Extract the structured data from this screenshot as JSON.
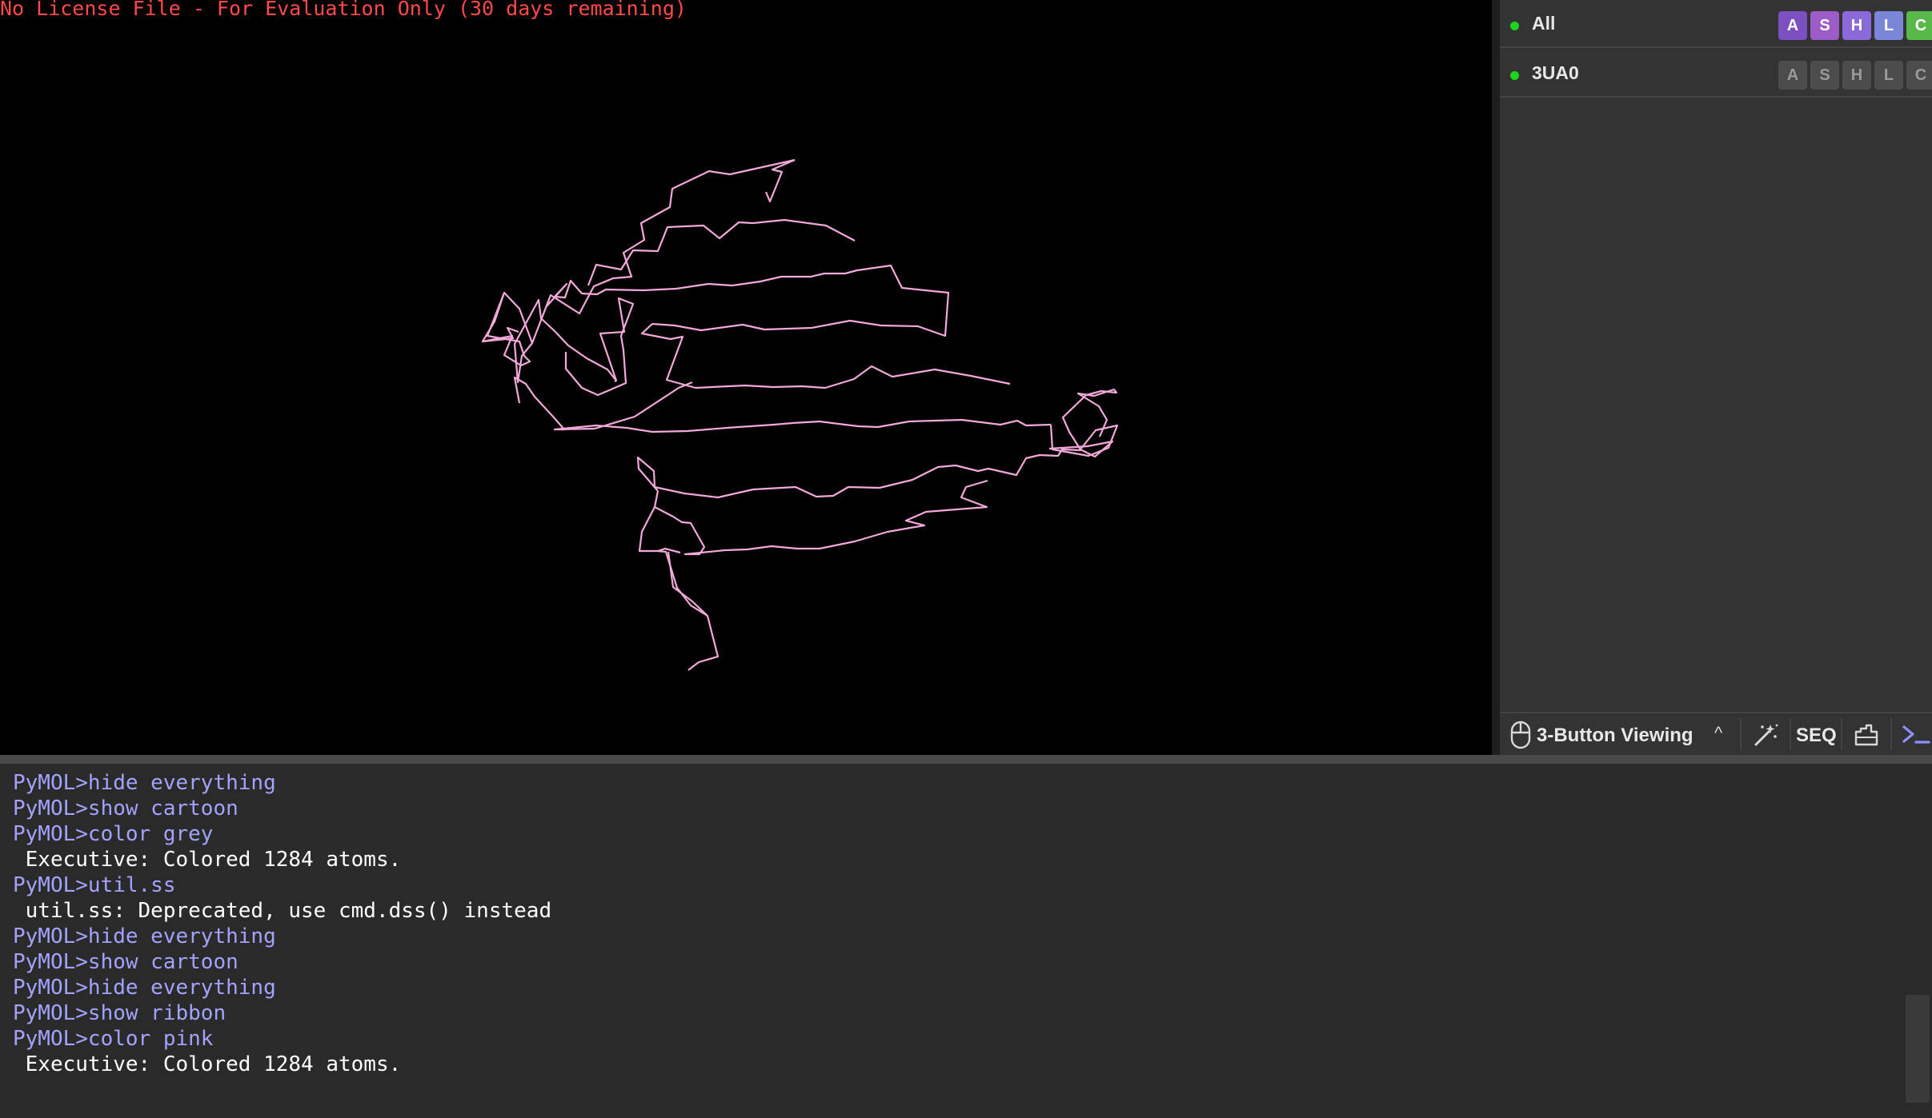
{
  "viewport": {
    "license_text": "No License File - For Evaluation Only (30 days remaining)",
    "representation": "ribbon",
    "molecule_color": "#f2a8d8"
  },
  "objects_panel": {
    "rows": [
      {
        "name": "All",
        "enabled": true,
        "buttons": [
          "A",
          "S",
          "H",
          "L",
          "C"
        ],
        "button_style": "colored"
      },
      {
        "name": "3UA0",
        "enabled": true,
        "buttons": [
          "A",
          "S",
          "H",
          "L",
          "C"
        ],
        "button_style": "dim"
      }
    ],
    "button_colors": {
      "A": "#7b4fc0",
      "S": "#9c5cc8",
      "H": "#8a6ad8",
      "L": "#7a86d8",
      "C": "#59b84a"
    }
  },
  "toolbar": {
    "mouse_mode_icon": "mouse-icon",
    "mouse_mode_label": "3-Button Viewing",
    "mouse_mode_chevron": "^",
    "wizard_icon": "magic-wand-icon",
    "seq_label": "SEQ",
    "builder_icon": "builder-icon",
    "console_icon": "terminal-prompt-icon"
  },
  "console": {
    "lines": [
      {
        "kind": "cmd",
        "text": "PyMOL>hide everything"
      },
      {
        "kind": "cmd",
        "text": "PyMOL>show cartoon"
      },
      {
        "kind": "cmd",
        "text": "PyMOL>color grey"
      },
      {
        "kind": "out",
        "text": " Executive: Colored 1284 atoms."
      },
      {
        "kind": "cmd",
        "text": "PyMOL>util.ss"
      },
      {
        "kind": "out",
        "text": " util.ss: Deprecated, use cmd.dss() instead"
      },
      {
        "kind": "cmd",
        "text": "PyMOL>hide everything"
      },
      {
        "kind": "cmd",
        "text": "PyMOL>show cartoon"
      },
      {
        "kind": "cmd",
        "text": "PyMOL>hide everything"
      },
      {
        "kind": "cmd",
        "text": "PyMOL>show ribbon"
      },
      {
        "kind": "cmd",
        "text": "PyMOL>color pink"
      },
      {
        "kind": "out",
        "text": " Executive: Colored 1284 atoms."
      }
    ]
  },
  "colors": {
    "license_red": "#ff4a4a",
    "prompt_blue": "#a3a3ff",
    "enabled_green": "#1ed41e",
    "console_icon_accent": "#8f8fff"
  }
}
